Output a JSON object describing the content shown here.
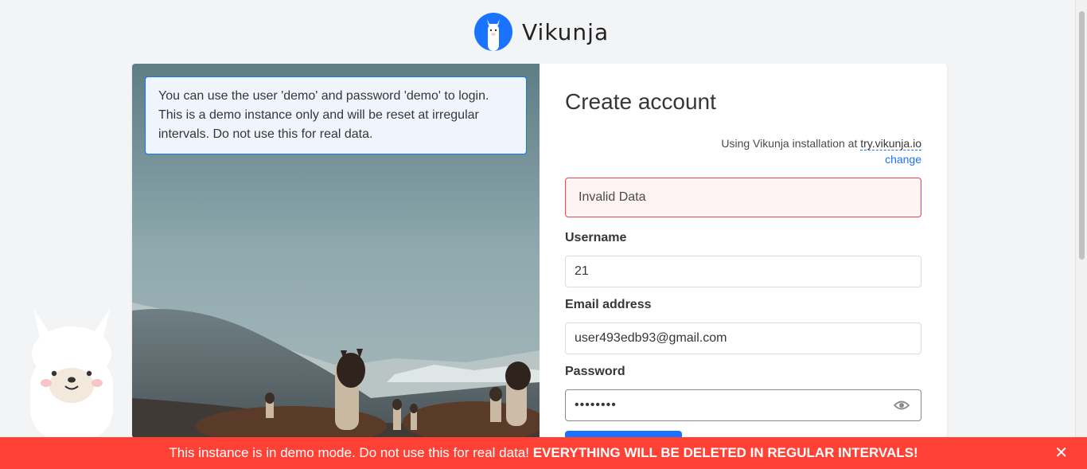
{
  "app": {
    "name": "Vikunja",
    "brand_color": "#1973ff"
  },
  "demo_notice": {
    "text": "You can use the user 'demo' and password 'demo' to login. This is a demo instance only and will be reset at irregular intervals. Do not use this for real data."
  },
  "form": {
    "title": "Create account",
    "install_prefix": "Using Vikunja installation at",
    "install_url": "try.vikunja.io",
    "change_label": "change",
    "error": "Invalid Data",
    "username_label": "Username",
    "username_value": "21",
    "email_label": "Email address",
    "email_value": "user493edb93@gmail.com",
    "password_label": "Password",
    "password_value": "••••••••"
  },
  "banner": {
    "text": "This instance is in demo mode. Do not use this for real data!",
    "emphasis": "EVERYTHING WILL BE DELETED IN REGULAR INTERVALS!",
    "close_icon": "close-icon",
    "color": "#ff4136"
  }
}
